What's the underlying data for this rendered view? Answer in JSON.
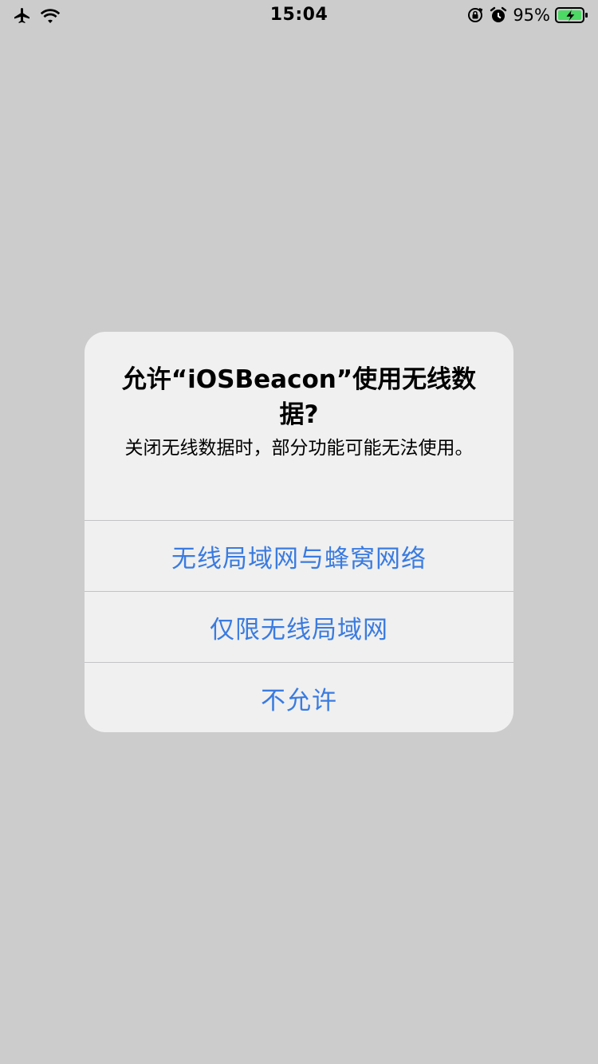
{
  "status_bar": {
    "time": "15:04",
    "battery_percent": "95%",
    "icons": [
      "airplane-mode-icon",
      "wifi-icon",
      "orientation-lock-icon",
      "alarm-icon",
      "battery-charging-icon"
    ]
  },
  "alert": {
    "title": "允许“iOSBeacon”使用无线数据?",
    "message": "关闭无线数据时，部分功能可能无法使用。",
    "buttons": [
      {
        "label": "无线局域网与蜂窝网络"
      },
      {
        "label": "仅限无线局域网"
      },
      {
        "label": "不允许"
      }
    ]
  },
  "colors": {
    "background": "#cccccc",
    "alert_background": "#f0f0f0",
    "button_text": "#3a7be0",
    "battery_fill": "#4cd964"
  }
}
